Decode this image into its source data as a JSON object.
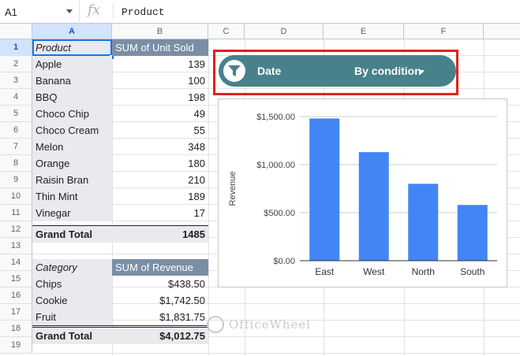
{
  "formula_bar": {
    "cell_ref": "A1",
    "fx_label": "fx",
    "content": "Product"
  },
  "columns": [
    {
      "label": "A",
      "selected": true
    },
    {
      "label": "B",
      "selected": false
    },
    {
      "label": "C",
      "selected": false
    },
    {
      "label": "D",
      "selected": false
    },
    {
      "label": "E",
      "selected": false
    },
    {
      "label": "F",
      "selected": false
    }
  ],
  "rows": [
    "1",
    "2",
    "3",
    "4",
    "5",
    "6",
    "7",
    "8",
    "9",
    "10",
    "11",
    "12",
    "13",
    "14",
    "15",
    "16",
    "17",
    "18",
    "19"
  ],
  "pivot1": {
    "headers": [
      "Product",
      "SUM of Unit Sold"
    ],
    "rows": [
      [
        "Apple",
        "139"
      ],
      [
        "Banana",
        "100"
      ],
      [
        "BBQ",
        "198"
      ],
      [
        "Choco Chip",
        "49"
      ],
      [
        "Choco Cream",
        "55"
      ],
      [
        "Melon",
        "348"
      ],
      [
        "Orange",
        "180"
      ],
      [
        "Raisin Bran",
        "210"
      ],
      [
        "Thin Mint",
        "189"
      ],
      [
        "Vinegar",
        "17"
      ]
    ],
    "total": [
      "Grand Total",
      "1485"
    ]
  },
  "pivot2": {
    "headers": [
      "Category",
      "SUM of Revenue"
    ],
    "rows": [
      [
        "Chips",
        "$438.50"
      ],
      [
        "Cookie",
        "$1,742.50"
      ],
      [
        "Fruit",
        "$1,831.75"
      ]
    ],
    "total": [
      "Grand Total",
      "$4,012.75"
    ]
  },
  "filter_chip": {
    "label": "Date",
    "condition": "By condition",
    "bg_color": "#47818c"
  },
  "chart_data": {
    "type": "bar",
    "categories": [
      "East",
      "West",
      "North",
      "South"
    ],
    "values": [
      1480,
      1130,
      800,
      580
    ],
    "ylabel": "Revenue",
    "ylim": [
      0,
      1500
    ],
    "yticks": [
      "$0.00",
      "$500.00",
      "$1,000.00",
      "$1,500.00"
    ],
    "bar_color": "#4285f4",
    "grid": true
  },
  "watermark": {
    "text": "OfficeWheel"
  }
}
